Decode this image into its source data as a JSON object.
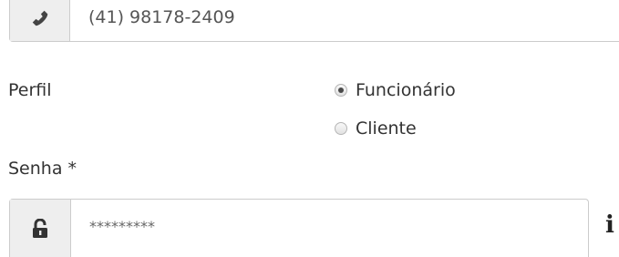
{
  "phone": {
    "value": "(41) 98178-2409",
    "icon": "phone-icon"
  },
  "perfil": {
    "label": "Perfil",
    "options": [
      {
        "label": "Funcionário",
        "checked": true
      },
      {
        "label": "Cliente",
        "checked": false
      }
    ]
  },
  "senha": {
    "label": "Senha *",
    "value": "*********",
    "icon": "unlock-icon",
    "info_icon": "info-icon",
    "info_glyph": "i"
  }
}
